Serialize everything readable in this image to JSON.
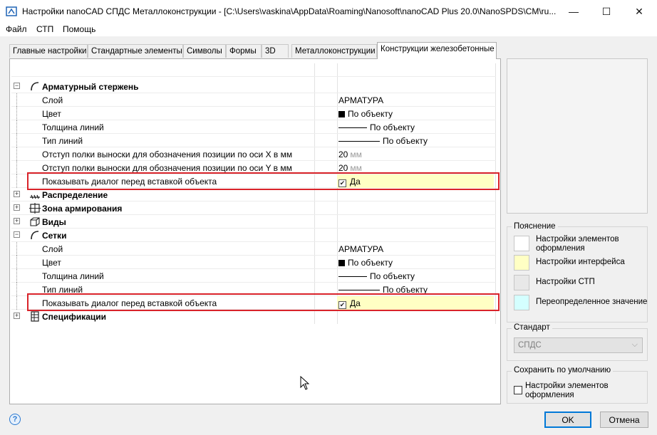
{
  "window": {
    "title": "Настройки nanoCAD СПДС Металлоконструкции - [C:\\Users\\vaskina\\AppData\\Roaming\\Nanosoft\\nanoCAD Plus 20.0\\NanoSPDS\\CM\\ru...",
    "minimize": "—",
    "maximize": "☐",
    "close": "✕"
  },
  "menu": [
    "Файл",
    "СТП",
    "Помощь"
  ],
  "tabs": [
    "Главные настройки",
    "Стандартные элементы",
    "Символы",
    "Формы",
    "3D",
    "Металлоконструкции",
    "Конструкции железобетонные"
  ],
  "active_tab": "Конструкции железобетонные",
  "tree": {
    "group1": {
      "label": "Арматурный стержень",
      "expander": "−",
      "layer": {
        "name": "Слой",
        "value": "АРМАТУРА"
      },
      "color": {
        "name": "Цвет",
        "value": "По объекту"
      },
      "lineweight": {
        "name": "Толщина линий",
        "value": "По объекту"
      },
      "linetype": {
        "name": "Тип линий",
        "value": "По объекту"
      },
      "offset_x": {
        "name": "Отступ полки выноски для обозначения позиции по оси X в мм",
        "value": "20",
        "unit": "мм"
      },
      "offset_y": {
        "name": "Отступ полки выноски для обозначения позиции по оси Y в мм",
        "value": "20",
        "unit": "мм"
      },
      "show_dialog": {
        "name": "Показывать диалог перед вставкой объекта",
        "value": "Да",
        "checked": true
      }
    },
    "group2": {
      "label": "Распределение",
      "expander": "+"
    },
    "group3": {
      "label": "Зона армирования",
      "expander": "+"
    },
    "group4": {
      "label": "Виды",
      "expander": "+"
    },
    "group5": {
      "label": "Сетки",
      "expander": "−",
      "layer": {
        "name": "Слой",
        "value": "АРМАТУРА"
      },
      "color": {
        "name": "Цвет",
        "value": "По объекту"
      },
      "lineweight": {
        "name": "Толщина линий",
        "value": "По объекту"
      },
      "linetype": {
        "name": "Тип линий",
        "value": "По объекту"
      },
      "show_dialog": {
        "name": "Показывать диалог перед вставкой объекта",
        "value": "Да",
        "checked": true
      }
    },
    "group6": {
      "label": "Спецификации",
      "expander": "+"
    }
  },
  "legend": {
    "title": "Пояснение",
    "items": [
      {
        "label": "Настройки элементов оформления",
        "color": "#ffffff"
      },
      {
        "label": "Настройки интерфейса",
        "color": "#ffffc4"
      },
      {
        "label": "Настройки СТП",
        "color": "#e8e8e8"
      },
      {
        "label": "Переопределенное значение",
        "color": "#d4ffff"
      }
    ]
  },
  "standard": {
    "title": "Стандарт",
    "value": "СПДС"
  },
  "save_default": {
    "title": "Сохранить по умолчанию",
    "checkbox_label": "Настройки элементов оформления",
    "checked": false
  },
  "buttons": {
    "ok": "OK",
    "cancel": "Отмена",
    "help": "?"
  },
  "colors": {
    "highlight_red": "#d9232a",
    "interface_yellow": "#ffffc4"
  }
}
